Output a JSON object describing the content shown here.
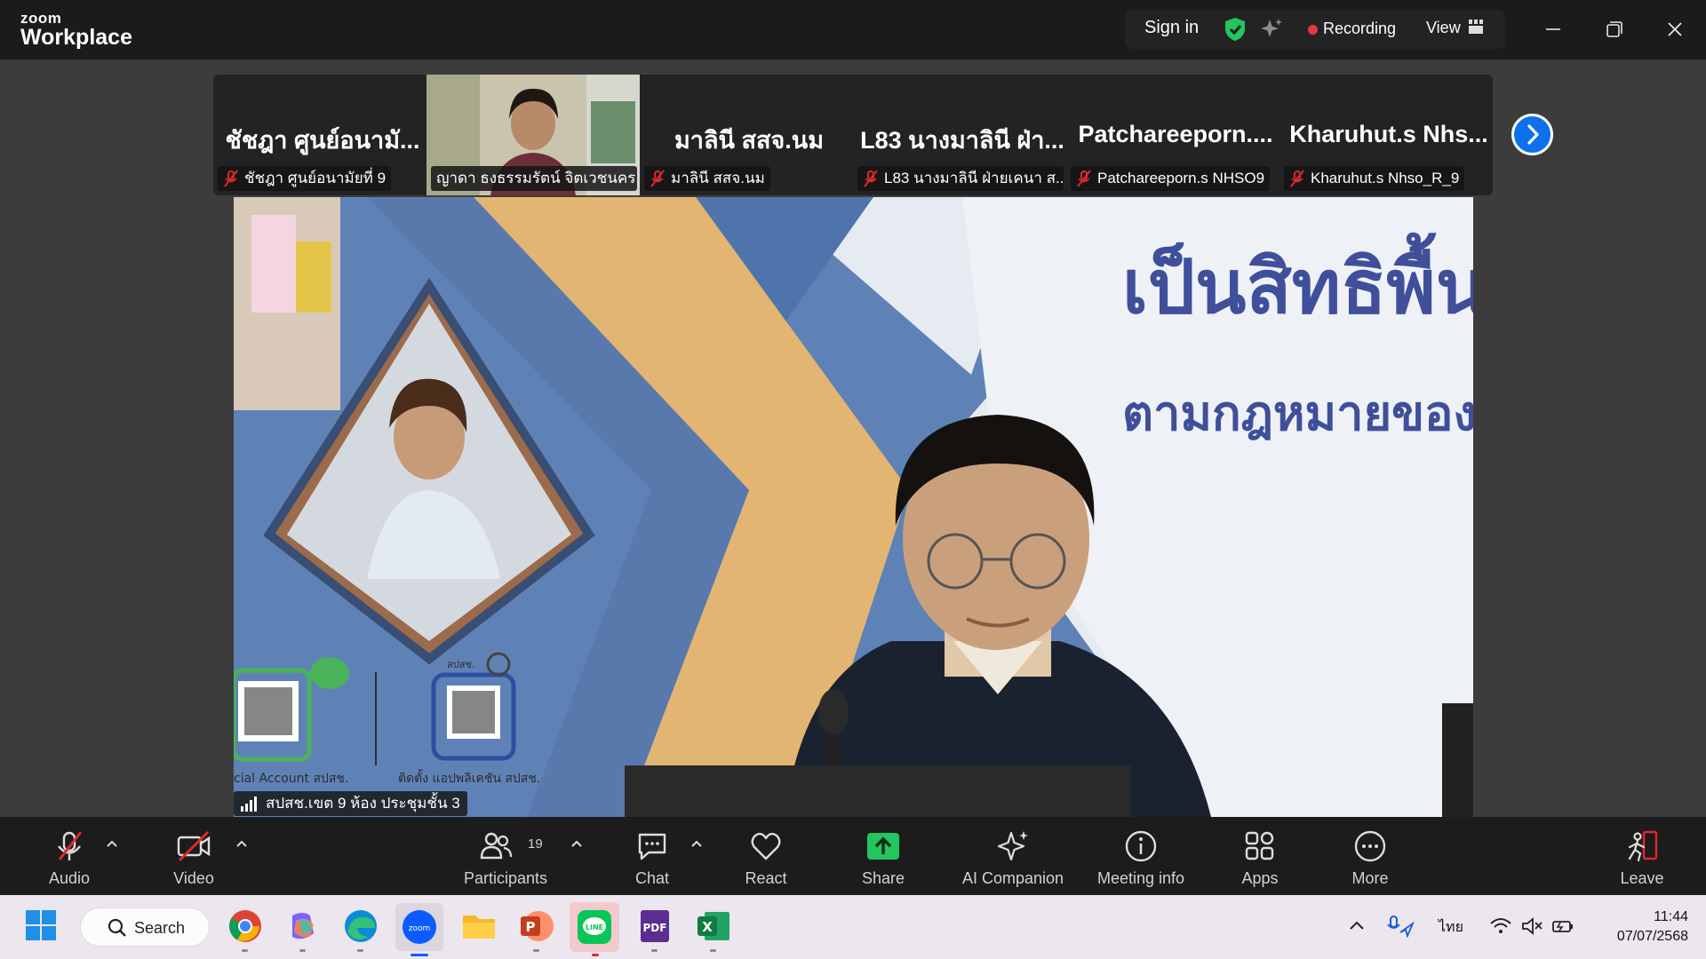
{
  "titlebar": {
    "logo_top": "zoom",
    "logo_bottom": "Workplace",
    "sign_in": "Sign in",
    "recording": "Recording",
    "view": "View"
  },
  "thumbnails": [
    {
      "big_name": "ชัชฎา ศูนย์อนามั...",
      "label": "ชัชฎา ศูนย์อนามัยที่ 9",
      "muted": true,
      "has_video": false
    },
    {
      "big_name": "",
      "label": "ญาดา ธงธรรมรัตน์ จิตเวชนคร...",
      "muted": false,
      "has_video": true
    },
    {
      "big_name": "มาลินี สสจ.นม",
      "label": "มาลินี สสจ.นม",
      "muted": true,
      "has_video": false
    },
    {
      "big_name": "L83 นางมาลินี ฝ่า...",
      "label": "L83 นางมาลินี ฝ่ายเคนา ส...",
      "muted": true,
      "has_video": false
    },
    {
      "big_name": "Patchareeporn....",
      "label": "Patchareeporn.s NHSO9",
      "muted": true,
      "has_video": false
    },
    {
      "big_name": "Kharuhut.s Nhs...",
      "label": "Kharuhut.s Nhso_R_9",
      "muted": true,
      "has_video": false
    }
  ],
  "main_video": {
    "caption": "สปสช.เขต 9 ห้อง ประชุมชั้น 3",
    "slide_line1": "เป็นสิทธิพื้น",
    "slide_line2": "ตามกฎหมายของ",
    "qr_caption_left": "cial Account สปสช.",
    "qr_caption_right": "ติดตั้ง แอปพลิเคชัน สปสช.",
    "qr_tag": "สปสช."
  },
  "toolbar": {
    "audio": "Audio",
    "video": "Video",
    "participants": "Participants",
    "participants_count": "19",
    "chat": "Chat",
    "react": "React",
    "share": "Share",
    "ai_companion": "AI Companion",
    "meeting_info": "Meeting info",
    "apps": "Apps",
    "more": "More",
    "leave": "Leave"
  },
  "taskbar": {
    "search": "Search",
    "language": "ไทย",
    "time": "11:44",
    "date": "07/07/2568"
  },
  "colors": {
    "accent_blue": "#0e71eb",
    "share_green": "#22c55e",
    "recording_red": "#e8383d",
    "muted_red": "#e02828"
  }
}
